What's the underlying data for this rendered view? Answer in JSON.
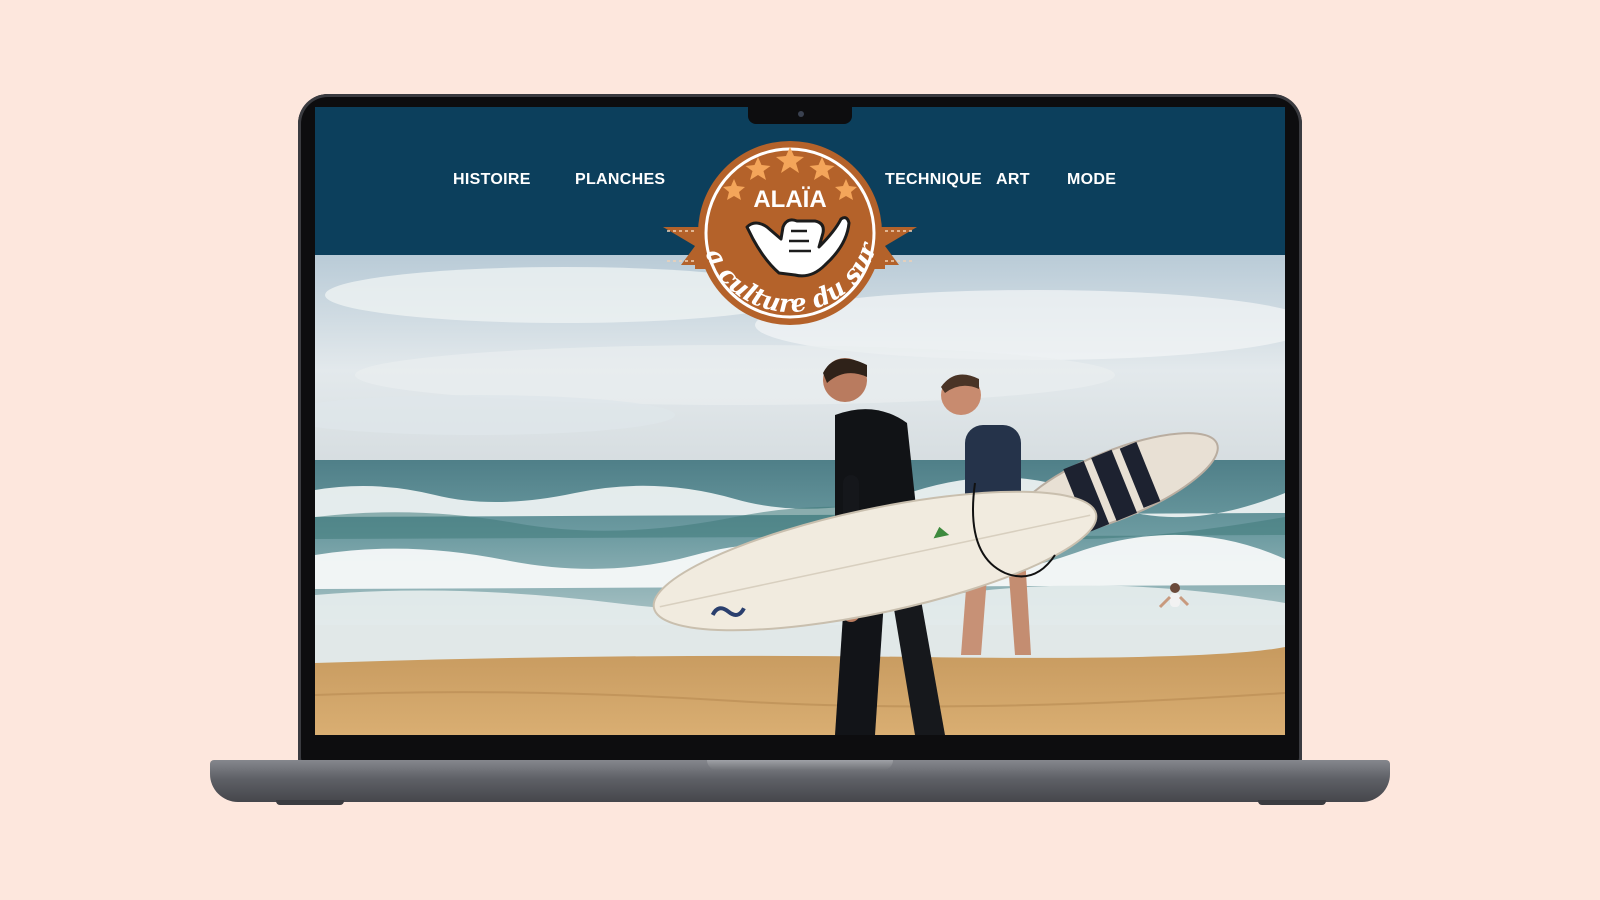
{
  "site": {
    "brand": "ALAÏA",
    "tagline": "La culture du surf",
    "colors": {
      "navbar": "#0c3f5c",
      "logo_brown": "#b4622a",
      "star_orange": "#f4a55a",
      "page_background": "#fde7dd"
    }
  },
  "nav": {
    "items": [
      {
        "label": "HISTOIRE"
      },
      {
        "label": "PLANCHES"
      },
      {
        "label": "TECHNIQUE"
      },
      {
        "label": "ART"
      },
      {
        "label": "MODE"
      }
    ]
  },
  "hero": {
    "image_subject": "two surfers carrying surfboards on a beach"
  },
  "icons": {
    "logo_hand": "shaka-hand-icon",
    "logo_stars": "star-icon"
  }
}
